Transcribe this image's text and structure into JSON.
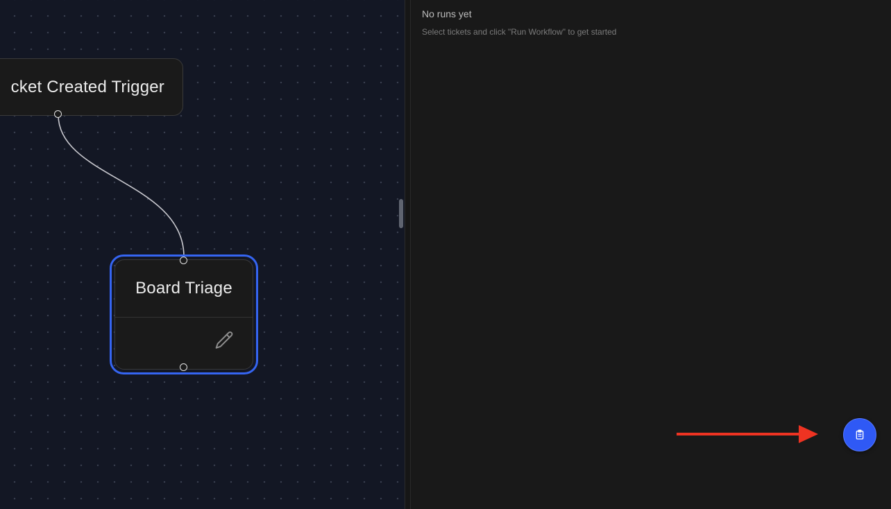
{
  "canvas": {
    "nodes": {
      "trigger": {
        "title": "cket Created Trigger"
      },
      "triage": {
        "title": "Board Triage",
        "edit_icon": "pencil-icon"
      }
    }
  },
  "runs_panel": {
    "empty_title": "No runs yet",
    "empty_hint": "Select tickets and click \"Run Workflow\" to get started"
  },
  "fab": {
    "icon": "clipboard-icon"
  },
  "colors": {
    "accent": "#3565f2",
    "fab": "#2f59f5",
    "annotation_arrow": "#ee3322",
    "canvas_bg": "#131724",
    "panel_bg": "#191919"
  }
}
